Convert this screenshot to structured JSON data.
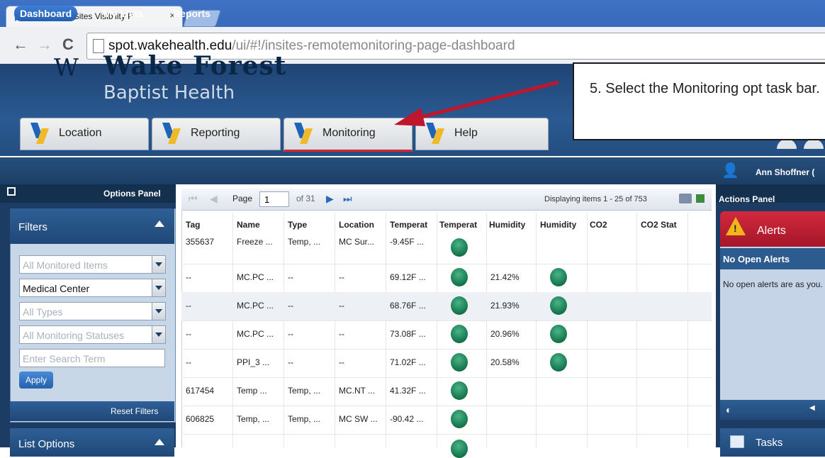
{
  "browser": {
    "tab_title": "Intelligent InSites Visibility P",
    "tab_close": "×",
    "back_glyph": "←",
    "forward_glyph": "→",
    "reload_glyph": "C",
    "url_domain": "spot.wakehealth.edu",
    "url_path": "/ui/#!/insites-remotemonitoring-page-dashboard"
  },
  "brand": {
    "mark": "W",
    "line1": "Wake Forest",
    "line2": "Baptist Health"
  },
  "main_nav": [
    {
      "label": "Location"
    },
    {
      "label": "Reporting"
    },
    {
      "label": "Monitoring"
    },
    {
      "label": "Help"
    }
  ],
  "annotation": {
    "text": "5.  Select the Monitoring opt task bar."
  },
  "sub_nav": {
    "dashboard": "Dashboard",
    "my_lists": "My Lists",
    "reports": "Reports",
    "user_name": "Ann Shoffner ("
  },
  "options_panel": {
    "label": "Options Panel",
    "filters_title": "Filters",
    "filter1": "All Monitored Items",
    "filter2": "Medical Center",
    "filter3": "All Types",
    "filter4": "All Monitoring Statuses",
    "search_placeholder": "Enter Search Term",
    "apply": "Apply",
    "reset": "Reset Filters",
    "list_options": "List Options"
  },
  "pager": {
    "page_label": "Page",
    "page_value": "1",
    "of_label": "of 31",
    "first": "⏮",
    "prev": "◀",
    "next": "▶",
    "last": "⏭",
    "displaying": "Displaying items 1 - 25 of 753"
  },
  "columns": [
    "Tag",
    "Name",
    "Type",
    "Location",
    "Temperat",
    "Temperat",
    "Humidity",
    "Humidity",
    "CO2",
    "CO2 Stat"
  ],
  "rows": [
    {
      "tag": "355637",
      "name": "Freeze ...",
      "type": "Temp, ...",
      "location": "MC Sur...",
      "temp": "-9.45F ...",
      "humidity": ""
    },
    {
      "tag": "--",
      "name": "MC.PC ...",
      "type": "--",
      "location": "--",
      "temp": "69.12F ...",
      "humidity": "21.42%"
    },
    {
      "tag": "--",
      "name": "MC.PC ...",
      "type": "--",
      "location": "--",
      "temp": "68.76F ...",
      "humidity": "21.93%"
    },
    {
      "tag": "--",
      "name": "MC.PC ...",
      "type": "--",
      "location": "--",
      "temp": "73.08F ...",
      "humidity": "20.96%"
    },
    {
      "tag": "--",
      "name": "PPI_3 ...",
      "type": "--",
      "location": "--",
      "temp": "71.02F ...",
      "humidity": "20.58%"
    },
    {
      "tag": "617454",
      "name": "Temp ...",
      "type": "Temp, ...",
      "location": "MC.NT ...",
      "temp": "41.32F ...",
      "humidity": ""
    },
    {
      "tag": "606825",
      "name": "Temp, ...",
      "type": "Temp, ...",
      "location": "MC SW ...",
      "temp": "-90.42 ...",
      "humidity": ""
    }
  ],
  "actions_panel": {
    "label": "Actions Panel",
    "alerts_title": "Alerts",
    "no_open_title": "No Open Alerts",
    "no_open_msg": "No open alerts are as you.",
    "tasks_title": "Tasks"
  },
  "colors": {
    "accent": "#2460b0",
    "alert_red": "#c1182d",
    "status_green": "#14734a",
    "annotation_arrow": "#c0162d"
  },
  "icons": {
    "user": "user-icon",
    "print": "print-icon",
    "export": "export-icon",
    "alert": "warning-icon",
    "tasks": "tasks-icon"
  }
}
